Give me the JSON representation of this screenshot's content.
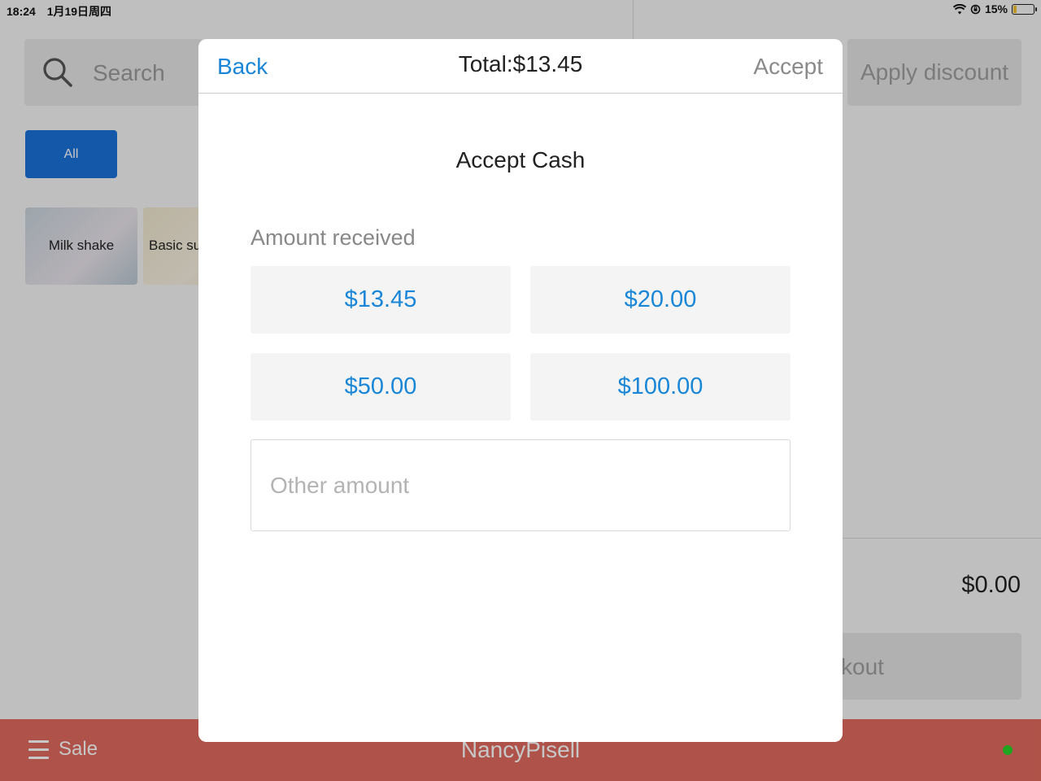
{
  "status_bar": {
    "time": "18:24",
    "date": "1月19日周四",
    "battery_percent": "15%",
    "battery_level": 0.15
  },
  "background": {
    "search_placeholder": "Search",
    "category_all": "All",
    "products": [
      "Milk shake",
      "Basic su"
    ],
    "apply_discount": "Apply discount",
    "cart_total": "$0.00",
    "checkout_partial": "kout",
    "menu_label": "Sale",
    "user_name": "NancyPisell",
    "online_color": "#28d428"
  },
  "modal": {
    "back": "Back",
    "total": "Total:$13.45",
    "accept": "Accept",
    "title": "Accept Cash",
    "amount_label": "Amount received",
    "amount_buttons": [
      "$13.45",
      "$20.00",
      "$50.00",
      "$100.00"
    ],
    "other_placeholder": "Other amount"
  },
  "colors": {
    "accent": "#1a86d8",
    "bottom_bar": "#e06a5e",
    "all_button": "#1a73d9"
  }
}
